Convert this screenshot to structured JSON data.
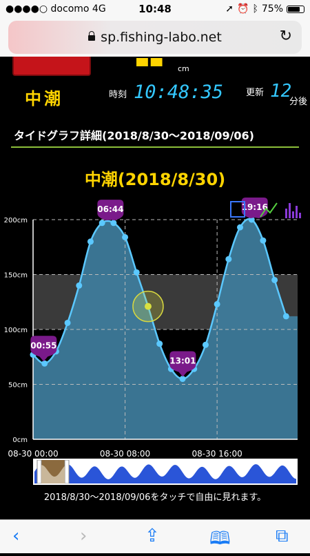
{
  "status_bar": {
    "carrier": "docomo",
    "network": "4G",
    "time": "10:48",
    "battery": "75%",
    "battery_level": 0.75
  },
  "browser": {
    "url": "sp.fishing-labo.net"
  },
  "header": {
    "unit_cm": "cm",
    "tide_name": "中潮",
    "time_label": "時刻",
    "time_value": "10:48:35",
    "update_label": "更新",
    "update_value": "12",
    "update_suffix": "分後"
  },
  "section_title": "タイドグラフ詳細(2018/8/30〜2018/09/06)",
  "chart_title": "中潮(2018/8/30)",
  "hint": "2018/8/30〜2018/09/06をタッチで自由に見れます。",
  "colors": {
    "accent_yellow": "#ffd400",
    "digit_blue": "#34c8ff",
    "marker_purple": "#7a1a8a",
    "area_blue": "#3f7e9e",
    "line_blue": "#5bc8ff",
    "rule_green": "#8cbf3a"
  },
  "chart_data": {
    "type": "area",
    "x_unit": "hour",
    "x_tick_labels": [
      "08-30 00:00",
      "08-30 08:00",
      "08-30 16:00"
    ],
    "x_ticks": [
      0,
      8,
      16
    ],
    "xlim": [
      0,
      23
    ],
    "ylim": [
      0,
      200
    ],
    "y_tick_labels": [
      "0cm",
      "50cm",
      "100cm",
      "150cm",
      "200cm"
    ],
    "y_ticks": [
      0,
      50,
      100,
      150,
      200
    ],
    "highlight_band": [
      100,
      150
    ],
    "current_time_hour": 10.0,
    "current_value": 121,
    "points": [
      [
        0,
        77
      ],
      [
        1,
        69
      ],
      [
        2,
        80
      ],
      [
        3,
        106
      ],
      [
        4,
        140
      ],
      [
        5,
        180
      ],
      [
        6,
        197
      ],
      [
        7,
        197
      ],
      [
        8,
        184
      ],
      [
        9,
        152
      ],
      [
        10,
        121
      ],
      [
        11,
        87
      ],
      [
        12,
        64
      ],
      [
        13,
        55
      ],
      [
        14,
        64
      ],
      [
        15,
        86
      ],
      [
        16,
        123
      ],
      [
        17,
        164
      ],
      [
        18,
        193
      ],
      [
        19,
        200
      ],
      [
        20,
        181
      ],
      [
        21,
        145
      ],
      [
        22,
        112
      ]
    ],
    "markers": [
      {
        "label": "00:55",
        "x": 0.92,
        "y": 69
      },
      {
        "label": "06:44",
        "x": 6.73,
        "y": 198
      },
      {
        "label": "13:01",
        "x": 13.02,
        "y": 55
      },
      {
        "label": "19:16",
        "x": 19.27,
        "y": 200
      }
    ]
  },
  "icons": [
    "location-arrow-icon",
    "alarm-icon",
    "bluetooth-icon",
    "lock-icon",
    "reload-icon",
    "back-icon",
    "forward-icon",
    "share-icon",
    "bookmarks-icon",
    "tabs-icon",
    "chart-type-icons"
  ]
}
